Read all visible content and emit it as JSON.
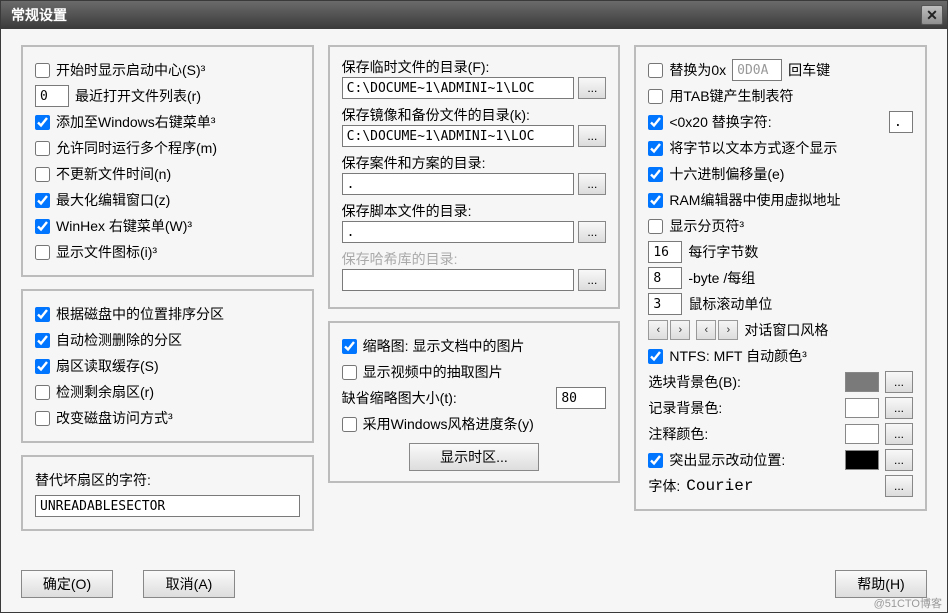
{
  "window": {
    "title": "常规设置"
  },
  "col1": {
    "g1": {
      "showStartup": "开始时显示启动中心(S)³",
      "recentCount": "0",
      "recentCountLabel": "最近打开文件列表(r)",
      "addWin": "添加至Windows右键菜单³",
      "allowMulti": "允许同时运行多个程序(m)",
      "noUpdateTime": "不更新文件时间(n)",
      "maxEditor": "最大化编辑窗口(z)",
      "winhexMenu": "WinHex 右键菜单(W)³",
      "showIcons": "显示文件图标(i)³"
    },
    "g2": {
      "sortByPos": "根据磁盘中的位置排序分区",
      "detectDeleted": "自动检测删除的分区",
      "sectorCache": "扇区读取缓存(S)",
      "detectLeft": "检测剩余扇区(r)",
      "changeAccess": "改变磁盘访问方式³"
    },
    "g3": {
      "badLabel": "替代坏扇区的字符:",
      "badValue": "UNREADABLESECTOR"
    }
  },
  "col2": {
    "g1": {
      "tempLabel": "保存临时文件的目录(F):",
      "tempPath": "C:\\DOCUME~1\\ADMINI~1\\LOC",
      "imgLabel": "保存镜像和备份文件的目录(k):",
      "imgPath": "C:\\DOCUME~1\\ADMINI~1\\LOC",
      "caseLabel": "保存案件和方案的目录:",
      "casePath": ".",
      "scriptLabel": "保存脚本文件的目录:",
      "scriptPath": ".",
      "hashLabel": "保存哈希库的目录:",
      "hashPath": ""
    },
    "g2": {
      "thumbDoc": "缩略图: 显示文档中的图片",
      "thumbVideo": "显示视频中的抽取图片",
      "defThumbLabel": "缺省缩略图大小(t):",
      "defThumbVal": "80",
      "winProgress": "采用Windows风格进度条(y)",
      "tzBtn": "显示时区..."
    }
  },
  "col3": {
    "g1": {
      "replace0x": "替换为0x",
      "zeroVal": "0D0A",
      "enterKey": "回车键",
      "tabMakes": "用TAB键产生制表符",
      "lt20": "<0x20 替换字符:",
      "lt20val": ".",
      "byteText": "将字节以文本方式逐个显示",
      "hexOffset": "十六进制偏移量(e)",
      "ramVirt": "RAM编辑器中使用虚拟地址",
      "pageMarker": "显示分页符³",
      "bplVal": "16",
      "bplLabel": "每行字节数",
      "bpgVal": "8",
      "bpgLabel": "-byte /每组",
      "scrollVal": "3",
      "scrollLabel": "鼠标滚动单位",
      "dlgStyle": "对话窗口风格",
      "ntfs": "NTFS: MFT 自动颜色³",
      "selBgLabel": "选块背景色(B):",
      "recBgLabel": "记录背景色:",
      "cmtLabel": "注释颜色:",
      "hlChange": "突出显示改动位置:",
      "fontLabel": "字体:",
      "fontVal": "Courier"
    }
  },
  "footer": {
    "ok": "确定(O)",
    "cancel": "取消(A)",
    "help": "帮助(H)"
  },
  "watermark": "@51CTO博客"
}
